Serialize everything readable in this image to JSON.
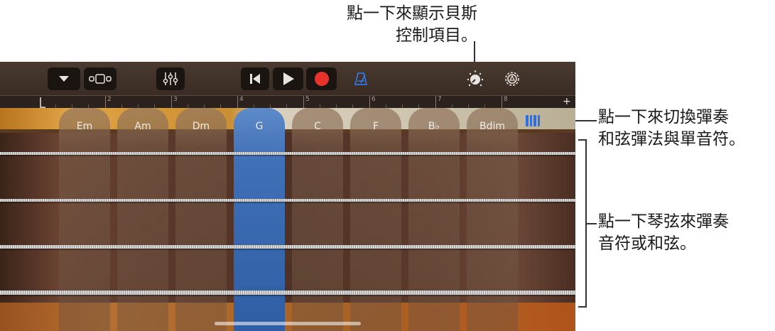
{
  "callouts": {
    "top": {
      "line1": "點一下來顯示貝斯",
      "line2": "控制項目。"
    },
    "right1": {
      "line1": "點一下來切換彈奏",
      "line2": "和弦彈法與單音符。"
    },
    "right2": {
      "line1": "點一下琴弦來彈奏",
      "line2": "音符或和弦。"
    }
  },
  "toolbar": {
    "buttons": [
      {
        "name": "browser-menu-button",
        "icon": "triangle-down-icon"
      },
      {
        "name": "view-toggle-button",
        "icon": "view-icon"
      },
      {
        "name": "mixer-button",
        "icon": "sliders-icon"
      },
      {
        "name": "go-to-beginning-button",
        "icon": "skip-back-icon"
      },
      {
        "name": "play-button",
        "icon": "play-icon"
      },
      {
        "name": "record-button",
        "icon": "record-icon"
      },
      {
        "name": "metronome-button",
        "icon": "metronome-icon"
      },
      {
        "name": "controls-knob-button",
        "icon": "knob-icon"
      },
      {
        "name": "settings-button",
        "icon": "gear-icon"
      }
    ],
    "colors": {
      "record": "#e8322a",
      "metronome": "#2f7fff"
    }
  },
  "ruler": {
    "bars": [
      "2",
      "3",
      "4",
      "5",
      "6",
      "7",
      "8"
    ],
    "add_label": "+"
  },
  "chords": [
    {
      "label": "Em",
      "active": false
    },
    {
      "label": "Am",
      "active": false
    },
    {
      "label": "Dm",
      "active": false
    },
    {
      "label": "G",
      "active": true
    },
    {
      "label": "C",
      "active": false
    },
    {
      "label": "F",
      "active": false
    },
    {
      "label": "B♭",
      "active": false
    },
    {
      "label": "Bdim",
      "active": false
    }
  ],
  "strings_count": 4,
  "colors": {
    "accent": "#2f6fe0",
    "active_chord": "#3f6fb6"
  }
}
